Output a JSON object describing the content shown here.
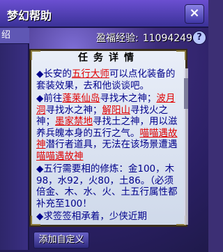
{
  "window": {
    "title": "梦幻帮助",
    "close_label": "×",
    "left_tab": "绍"
  },
  "exp": {
    "label": "盈福经验:",
    "value": "11094249",
    "help_label": "?"
  },
  "panel": {
    "header": "任务详情",
    "content": {
      "para1_prefix": "◆长安的",
      "para1_link": "五行大师",
      "para1_suffix": "可以点化装备的套装效果，去和他谈谈吧。",
      "para2_prefix": "◆前往",
      "para2_link1": "蓬莱仙岛",
      "para2_mid1": "寻找木之神；",
      "para2_link2": "波月洞",
      "para2_mid2": "寻找水之神；",
      "para2_link3": "解阳山",
      "para2_mid3": "寻找火之神；",
      "para2_link4": "墨家禁地",
      "para2_mid4": "寻找土之神，用以滋养兵魄本身的五行之气。",
      "para2_link5": "喵喵遇故神",
      "para2_mid5": "潜行者道具，无法在该场景遭遇",
      "para2_link6": "喵喵遇故神",
      "para3": "◆五行需要相的修炼：金100，木98，水92，火80，土86。（必须倍金、木、水、火、土五行属性都补充至100！",
      "para4": "◆求签签相承着，少侠近期"
    }
  },
  "bottom": {
    "button_label": "添加自定义"
  }
}
